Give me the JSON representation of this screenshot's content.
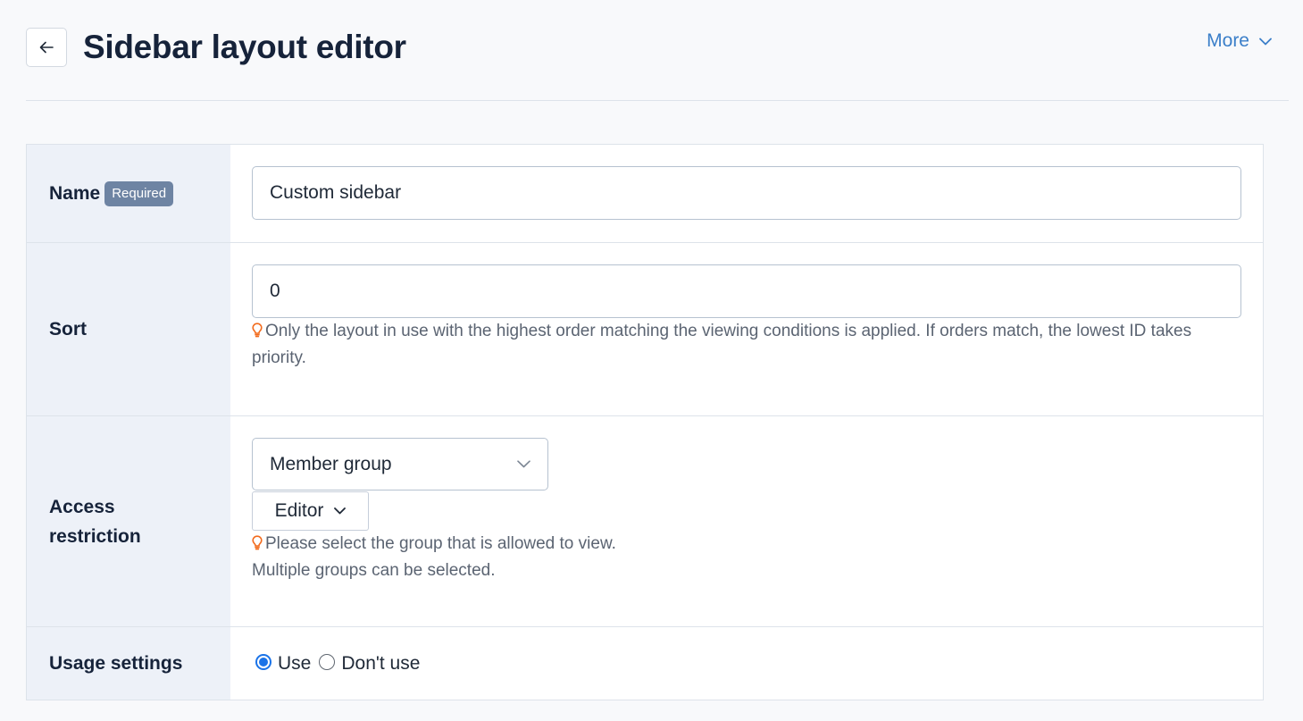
{
  "header": {
    "title": "Sidebar layout editor",
    "more_label": "More"
  },
  "form": {
    "name": {
      "label": "Name",
      "badge": "Required",
      "value": "Custom sidebar"
    },
    "sort": {
      "label": "Sort",
      "value": "0",
      "hint": "Only the layout in use with the highest order matching the viewing conditions is applied. If orders match, the lowest ID takes priority."
    },
    "access": {
      "label": "Access restriction",
      "select_value": "Member group",
      "group_value": "Editor",
      "hint_line1": "Please select the group that is allowed to view.",
      "hint_line2": "Multiple groups can be selected."
    },
    "usage": {
      "label": "Usage settings",
      "option_use": "Use",
      "option_dont_use": "Don't use",
      "selected": "Use"
    }
  },
  "colors": {
    "accent": "#3b7fc9",
    "hint_icon": "#f26b1d",
    "radio_selected": "#1a73e8"
  }
}
